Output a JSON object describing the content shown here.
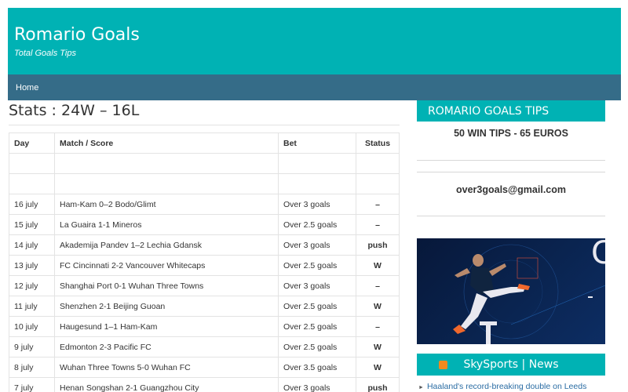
{
  "site": {
    "title": "Romario Goals",
    "description": "Total Goals Tips"
  },
  "nav": {
    "home": "Home"
  },
  "main": {
    "stats": "Stats : 24W – 16L",
    "columns": [
      "Day",
      "Match / Score",
      "Bet",
      "Status"
    ],
    "rows": [
      [
        "",
        "",
        "",
        ""
      ],
      [
        "",
        "",
        "",
        ""
      ],
      [
        "16 july",
        "Ham-Kam 0–2 Bodo/Glimt",
        "Over 3 goals",
        "–"
      ],
      [
        "15 july",
        "La Guaira 1-1 Mineros",
        "Over 2.5 goals",
        "–"
      ],
      [
        "14 july",
        "Akademija Pandev 1–2 Lechia Gdansk",
        "Over 3 goals",
        "push"
      ],
      [
        "13 july",
        "FC Cincinnati 2-2 Vancouver Whitecaps",
        "Over 2.5 goals",
        "W"
      ],
      [
        "12 july",
        "Shanghai Port 0-1 Wuhan Three Towns",
        "Over 3 goals",
        "–"
      ],
      [
        "11 july",
        "Shenzhen 2-1 Beijing Guoan",
        "Over 2.5 goals",
        "W"
      ],
      [
        "10 july",
        "Haugesund 1–1 Ham-Kam",
        "Over 2.5 goals",
        "–"
      ],
      [
        "9 july",
        "Edmonton 2-3 Pacific FC",
        "Over 2.5 goals",
        "W"
      ],
      [
        "8 july",
        "Wuhan Three Towns 5-0 Wuhan FC",
        "Over 3.5 goals",
        "W"
      ],
      [
        "7 july",
        "Henan Songshan 2-1 Guangzhou City",
        "Over 3 goals",
        "push"
      ]
    ]
  },
  "sidebar": {
    "widget_title": "ROMARIO GOALS TIPS",
    "promo": "50 WIN TIPS - 65 EUROS",
    "email": "over3goals@gmail.com",
    "sky_title": "SkySports | News",
    "news": [
      "Haaland's record-breaking double on Leeds return narrows gap to Arsenal"
    ]
  },
  "colors": {
    "teal": "#00b2b4",
    "nav": "#356c88",
    "banner": "#0a2450",
    "accent_orange": "#f0682c"
  }
}
